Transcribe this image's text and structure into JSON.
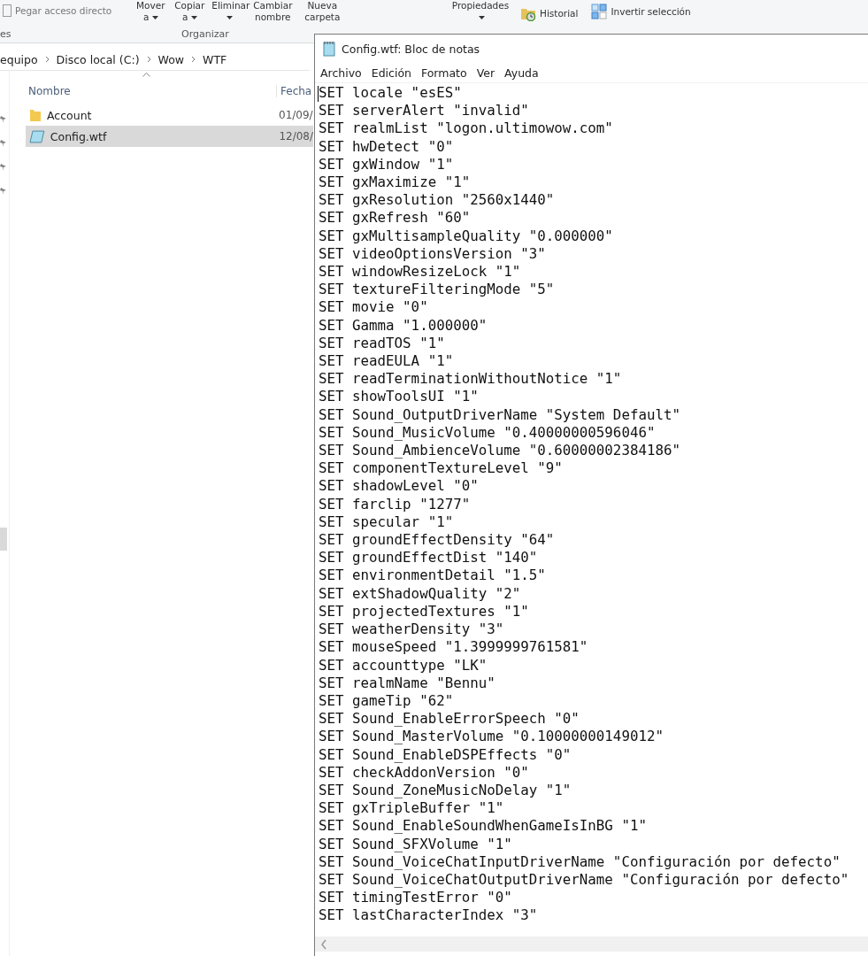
{
  "explorer": {
    "ribbon": {
      "commands": [
        {
          "label": "Pegar acceso directo",
          "kind": "small"
        },
        {
          "label": "Mover\na",
          "kind": "split"
        },
        {
          "label": "Copiar\na",
          "kind": "split"
        },
        {
          "label": "Eliminar",
          "kind": "split"
        },
        {
          "label": "Cambiar\nnombre",
          "kind": "large"
        },
        {
          "label": "Nueva\ncarpeta",
          "kind": "large"
        }
      ],
      "groups": [
        "es",
        "Organizar"
      ]
    },
    "breadcrumb": [
      "equipo",
      "Disco local (C:)",
      "Wow",
      "WTF"
    ],
    "columns": [
      "Nombre",
      "Fecha"
    ],
    "files": [
      {
        "name": "Account",
        "date": "01/09/",
        "kind": "folder",
        "selected": false
      },
      {
        "name": "Config.wtf",
        "date": "12/08/",
        "kind": "text",
        "selected": true
      }
    ]
  },
  "ribbon_right": {
    "commands": [
      {
        "label": "Propiedades",
        "kind": "split"
      },
      {
        "label": "Historial",
        "kind": "history"
      },
      {
        "label": "Invertir selección",
        "kind": "invert"
      }
    ]
  },
  "notepad": {
    "title": "Config.wtf: Bloc de notas",
    "menu": [
      "Archivo",
      "Edición",
      "Formato",
      "Ver",
      "Ayuda"
    ],
    "lines": [
      "SET locale \"esES\"",
      "SET serverAlert \"invalid\"",
      "SET realmList \"logon.ultimowow.com\"",
      "SET hwDetect \"0\"",
      "SET gxWindow \"1\"",
      "SET gxMaximize \"1\"",
      "SET gxResolution \"2560x1440\"",
      "SET gxRefresh \"60\"",
      "SET gxMultisampleQuality \"0.000000\"",
      "SET videoOptionsVersion \"3\"",
      "SET windowResizeLock \"1\"",
      "SET textureFilteringMode \"5\"",
      "SET movie \"0\"",
      "SET Gamma \"1.000000\"",
      "SET readTOS \"1\"",
      "SET readEULA \"1\"",
      "SET readTerminationWithoutNotice \"1\"",
      "SET showToolsUI \"1\"",
      "SET Sound_OutputDriverName \"System Default\"",
      "SET Sound_MusicVolume \"0.40000000596046\"",
      "SET Sound_AmbienceVolume \"0.60000002384186\"",
      "SET componentTextureLevel \"9\"",
      "SET shadowLevel \"0\"",
      "SET farclip \"1277\"",
      "SET specular \"1\"",
      "SET groundEffectDensity \"64\"",
      "SET groundEffectDist \"140\"",
      "SET environmentDetail \"1.5\"",
      "SET extShadowQuality \"2\"",
      "SET projectedTextures \"1\"",
      "SET weatherDensity \"3\"",
      "SET mouseSpeed \"1.3999999761581\"",
      "SET accounttype \"LK\"",
      "SET realmName \"Bennu\"",
      "SET gameTip \"62\"",
      "SET Sound_EnableErrorSpeech \"0\"",
      "SET Sound_MasterVolume \"0.10000000149012\"",
      "SET Sound_EnableDSPEffects \"0\"",
      "SET checkAddonVersion \"0\"",
      "SET Sound_ZoneMusicNoDelay \"1\"",
      "SET gxTripleBuffer \"1\"",
      "SET Sound_EnableSoundWhenGameIsInBG \"1\"",
      "SET Sound_SFXVolume \"1\"",
      "SET Sound_VoiceChatInputDriverName \"Configuración por defecto\"",
      "SET Sound_VoiceChatOutputDriverName \"Configuración por defecto\"",
      "SET timingTestError \"0\"",
      "SET lastCharacterIndex \"3\""
    ]
  }
}
